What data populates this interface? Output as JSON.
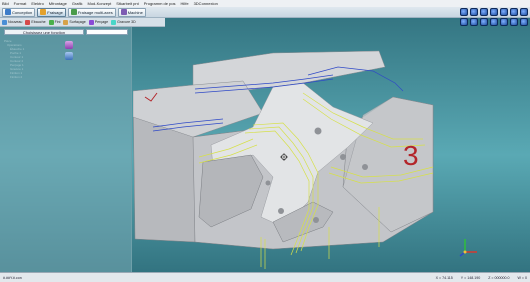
{
  "menu": [
    "Bild",
    "Format",
    "Elektro",
    "Mfrontage",
    "Grafik",
    "Mod-Konzept",
    "Stkarbeit pnt",
    "Programm de pos",
    "Hilfe",
    "3DConnexion"
  ],
  "tabs": [
    {
      "label": "Conception",
      "icon": "design-icon",
      "color": "#3d7cc9"
    },
    {
      "label": "Fraisage",
      "icon": "milling-icon",
      "color": "#e4a12d"
    },
    {
      "label": "Fraisage multi-axes",
      "icon": "multiaxis-icon",
      "color": "#4a9b4a"
    },
    {
      "label": "Machine",
      "icon": "machine-icon",
      "color": "#7d5bb2"
    }
  ],
  "subtools": [
    {
      "label": "Nouveau",
      "color": "#4a8fd6"
    },
    {
      "label": "Ebauche",
      "color": "#d64a4a"
    },
    {
      "label": "Fini",
      "color": "#4ab04a"
    },
    {
      "label": "Surfaçage",
      "color": "#d6a24a"
    },
    {
      "label": "Perçage",
      "color": "#8a4ad6"
    },
    {
      "label": "Gravure 3D",
      "color": "#4ad6c8"
    }
  ],
  "panel": {
    "header": "Choisissez une fonction",
    "tree": [
      "Pièce",
      "Opérations",
      "Ébauche 1",
      "Poche 1",
      "Contour 1",
      "Contour 2",
      "Perçage 1",
      "Gravure 1",
      "Finition 1",
      "Finition 2"
    ]
  },
  "model": {
    "label": "3",
    "label_color": "#b3252a"
  },
  "status": {
    "left": "#.##Y.#.con",
    "x": "X = 74.115",
    "y": "Y = 148.190",
    "z": "Z = 000000.0",
    "w": "W = 0"
  },
  "colors": {
    "background": "#4e9aa6",
    "part": "#c7c9cc",
    "toolpath": "#d6e04a",
    "path_blue": "#2f49c7"
  }
}
